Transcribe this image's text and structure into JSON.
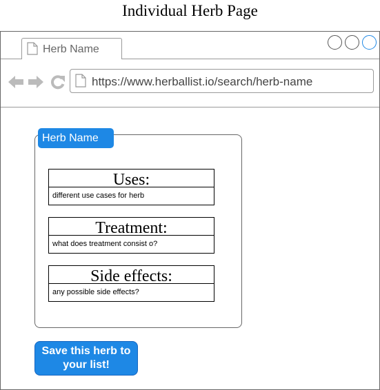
{
  "page": {
    "title": "Individual Herb Page"
  },
  "browser": {
    "tab_label": "Herb Name",
    "url": "https://www.herballist.io/search/herb-name",
    "icons": {
      "back": "arrow-left-icon",
      "forward": "arrow-right-icon",
      "reload": "reload-icon",
      "page": "document-icon"
    }
  },
  "herb": {
    "name": "Herb Name",
    "sections": [
      {
        "heading": "Uses:",
        "description": "different use cases for herb"
      },
      {
        "heading": "Treatment:",
        "description": "what does treatment consist o?"
      },
      {
        "heading": "Side effects:",
        "description": "any possible side effects?"
      }
    ],
    "save_label": "Save this herb to your list!"
  },
  "colors": {
    "accent": "#1e88e5",
    "border": "#666666",
    "nav_icon": "#bbbbbb"
  }
}
